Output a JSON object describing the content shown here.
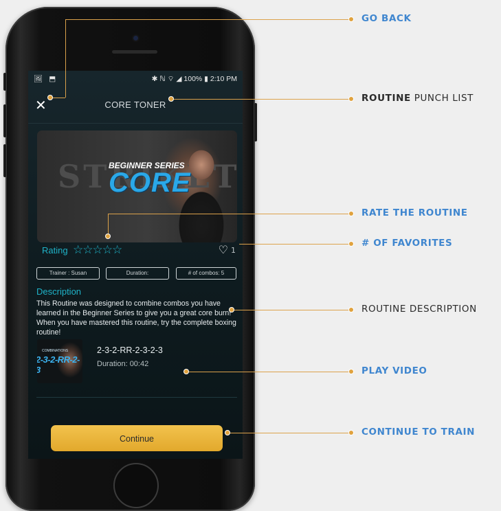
{
  "statusbar": {
    "left_icons": "🖼 ⬒",
    "right": "✱ ℕ ⌔ ◢ 100% ▮ 2:10 PM"
  },
  "app": {
    "title": "CORE TONER",
    "close_icon": "close-icon",
    "hero": {
      "bg_text": "STRIKETEC",
      "series": "BEGINNER SERIES",
      "core": "CORE"
    },
    "rating": {
      "label": "Rating",
      "stars": "☆☆☆☆☆",
      "value": 0
    },
    "favorites": {
      "heart": "♡",
      "count": "1"
    },
    "pills": {
      "trainer": "Trainer : Susan",
      "duration": "Duration:",
      "combos": "# of combos: 5"
    },
    "description": {
      "title": "Description",
      "text": "This Routine was designed to combine combos you have learned in the Beginner Series to give you a great core burn! When you have mastered this routine, try the complete boxing routine!"
    },
    "video": {
      "thumb_title": "2-3-2-RR-2-3",
      "thumb_sub": "COMBINATIONS",
      "title": "2-3-2-RR-2-3-2-3",
      "duration": "Duration: 00:42"
    },
    "continue_label": "Continue"
  },
  "callouts": {
    "go_back": "GO BACK",
    "routine_bold": "ROUTINE",
    "punch_list": "PUNCH LIST",
    "rate": "RATE THE ROUTINE",
    "favorites": "# OF FAVORITES",
    "description": "ROUTINE DESCRIPTION",
    "play_video": "PLAY VIDEO",
    "continue": "CONTINUE TO TRAIN"
  },
  "colors": {
    "accent_teal": "#1fb3c8",
    "callout_blue": "#3f86cf",
    "callout_line": "#dca24b",
    "button_gold": "#e2a92c"
  }
}
